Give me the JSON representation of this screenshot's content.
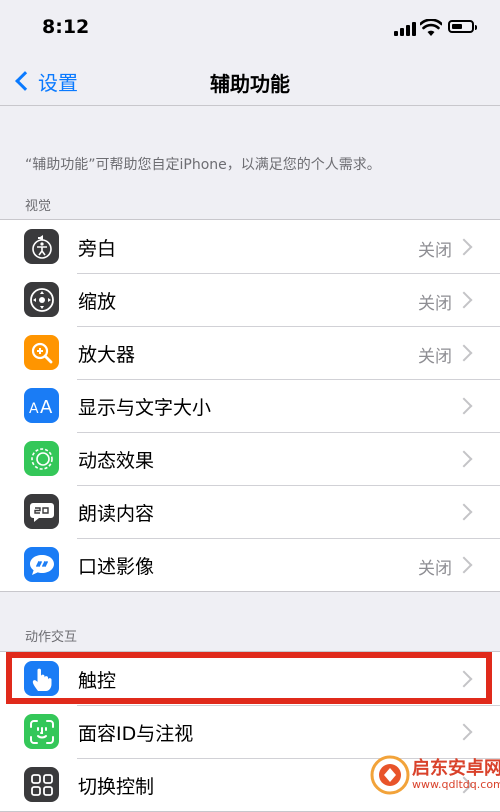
{
  "status_bar": {
    "time": "8:12"
  },
  "nav": {
    "back_label": "设置",
    "title": "辅助功能"
  },
  "description": "“辅助功能”可帮助您自定iPhone，以满足您的个人需求。",
  "sections": {
    "vision": {
      "header": "视觉",
      "rows": [
        {
          "label": "旁白",
          "value": "关闭",
          "icon": "voiceover-icon",
          "color": "#3a3a3c"
        },
        {
          "label": "缩放",
          "value": "关闭",
          "icon": "zoom-icon",
          "color": "#3a3a3c"
        },
        {
          "label": "放大器",
          "value": "关闭",
          "icon": "magnifier-icon",
          "color": "#ff9500"
        },
        {
          "label": "显示与文字大小",
          "value": "",
          "icon": "text-size-icon",
          "color": "#1a7cf5"
        },
        {
          "label": "动态效果",
          "value": "",
          "icon": "motion-icon",
          "color": "#34c759"
        },
        {
          "label": "朗读内容",
          "value": "",
          "icon": "spoken-content-icon",
          "color": "#3a3a3c"
        },
        {
          "label": "口述影像",
          "value": "关闭",
          "icon": "audio-description-icon",
          "color": "#1a7cf5"
        }
      ]
    },
    "interaction": {
      "header": "动作交互",
      "rows": [
        {
          "label": "触控",
          "value": "",
          "icon": "touch-icon",
          "color": "#1a7cf5"
        },
        {
          "label": "面容ID与注视",
          "value": "",
          "icon": "face-id-icon",
          "color": "#34c759"
        },
        {
          "label": "切换控制",
          "value": "",
          "icon": "switch-control-icon",
          "color": "#3a3a3c"
        }
      ]
    }
  },
  "watermark": {
    "name": "启东安卓网",
    "url": "www.qdltdq.com"
  }
}
